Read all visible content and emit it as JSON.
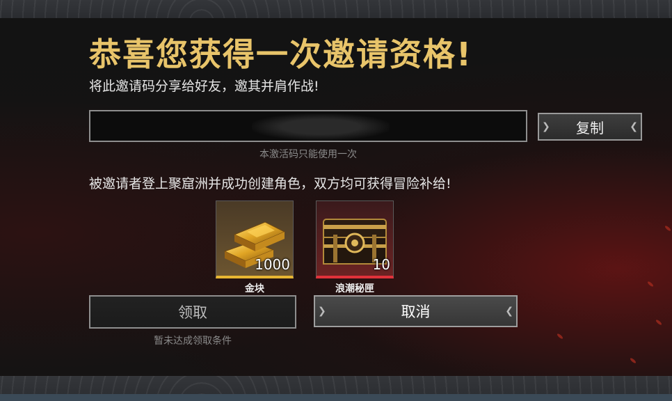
{
  "dialog": {
    "title": "恭喜您获得一次邀请资格!",
    "subtitle": "将此邀请码分享给好友，邀其并肩作战!",
    "invite_code": {
      "value": "",
      "hint": "本激活码只能使用一次"
    },
    "copy_button": {
      "label": "复制"
    },
    "invite_description": "被邀请者登上聚窟洲并成功创建角色，双方均可获得冒险补给!",
    "rewards": [
      {
        "name": "金块",
        "count": "1000",
        "icon": "gold-bars-icon",
        "rarity_color": "#e7b632"
      },
      {
        "name": "浪潮秘匣",
        "count": "10",
        "icon": "treasure-chest-icon",
        "rarity_color": "#e0313a"
      }
    ],
    "claim_button": {
      "label": "领取"
    },
    "claim_hint": "暂未达成领取条件",
    "cancel_button": {
      "label": "取消"
    }
  },
  "colors": {
    "title_gold": "#e8c46a",
    "background": "#141414"
  }
}
